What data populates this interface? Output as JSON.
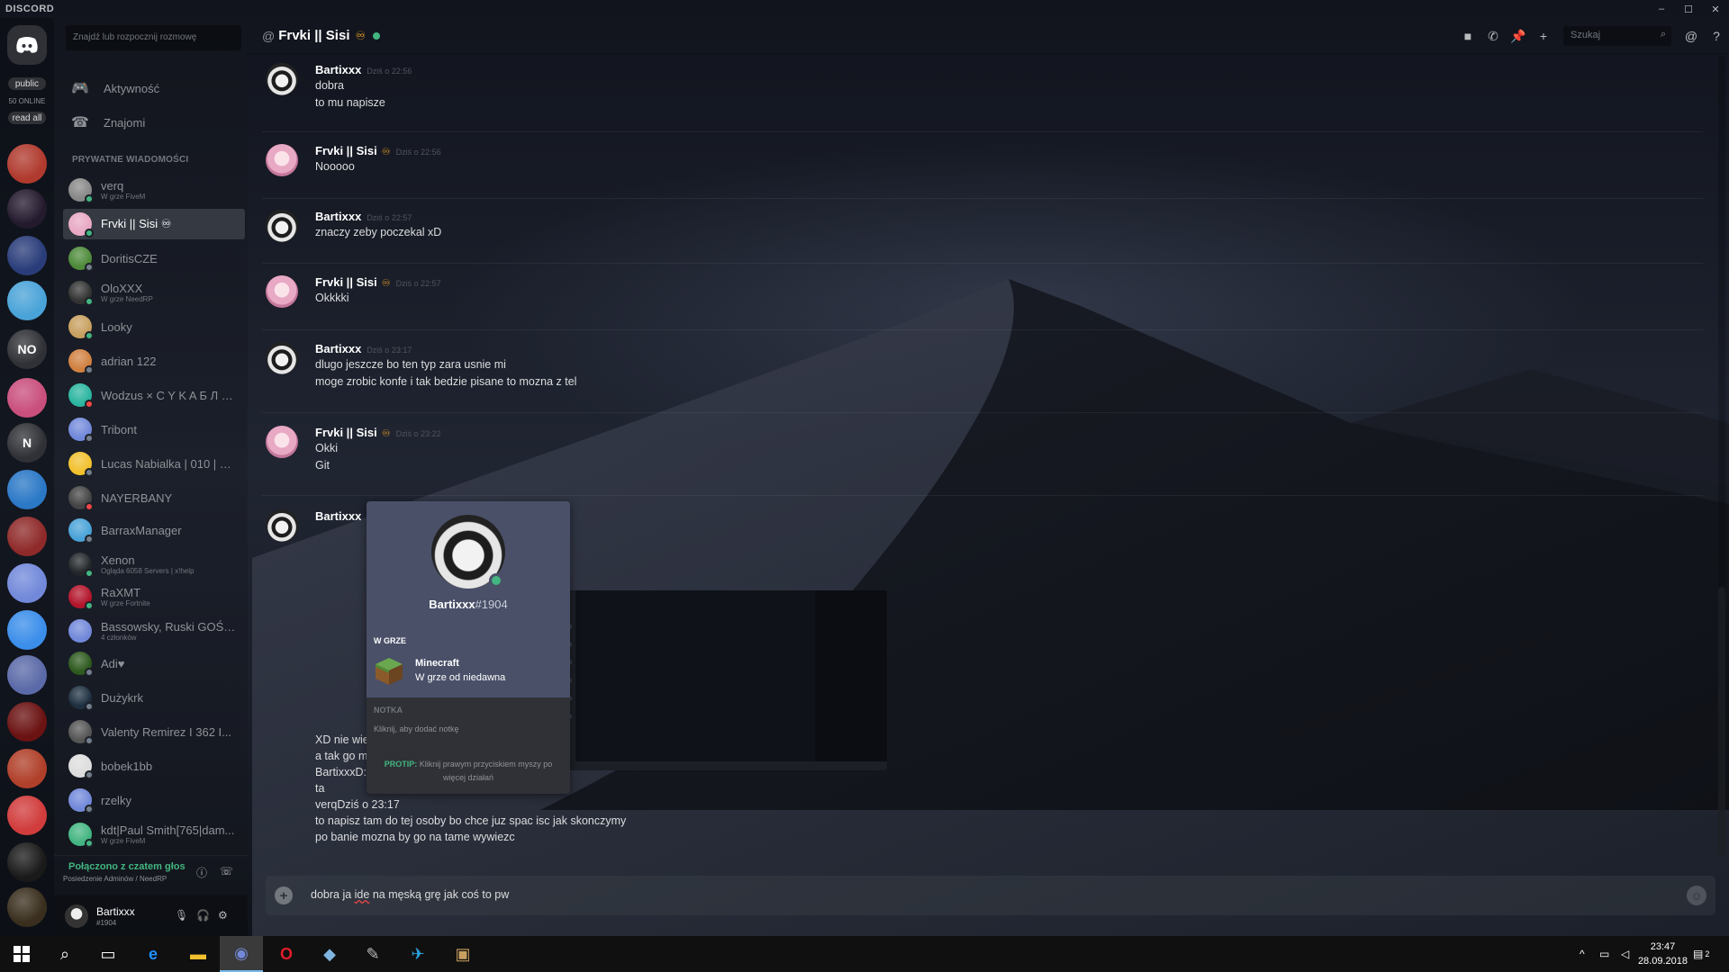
{
  "window": {
    "logo": "DISCORD",
    "controls": [
      "–",
      "☐",
      "✕"
    ]
  },
  "guilds": {
    "pill_public": "public",
    "online": "50 ONLINE",
    "pill_read": "read all",
    "items": [
      {
        "label": "",
        "color": "#b03a2e"
      },
      {
        "label": "",
        "color": "#241a2e"
      },
      {
        "label": "",
        "color": "#2a3d7a"
      },
      {
        "label": "",
        "color": "#4aa3d8"
      },
      {
        "label": "NO",
        "color": "#2f3136"
      },
      {
        "label": "",
        "color": "#c94f7c"
      },
      {
        "label": "N",
        "color": "#2f3136"
      },
      {
        "label": "",
        "color": "#2b78c6"
      },
      {
        "label": "",
        "color": "#8f2a2a"
      },
      {
        "label": "",
        "color": "#7289da"
      },
      {
        "label": "",
        "color": "#3b8eea"
      },
      {
        "label": "",
        "color": "#5b6aa8"
      },
      {
        "label": "",
        "color": "#6b1212"
      },
      {
        "label": "",
        "color": "#b0402a"
      },
      {
        "label": "",
        "color": "#d13c3c"
      },
      {
        "label": "",
        "color": "#1a1a1a"
      },
      {
        "label": "",
        "color": "#3a2f1e"
      }
    ]
  },
  "sidebar": {
    "search_placeholder": "Znajdź lub rozpocznij rozmowę",
    "nav": [
      {
        "label": "Aktywność",
        "icon": "gamepad-icon"
      },
      {
        "label": "Znajomi",
        "icon": "friends-icon"
      }
    ],
    "section": "PRYWATNE WIADOMOŚCI",
    "dms": [
      {
        "name": "verq",
        "sub": "W grze FiveM",
        "color": "#888",
        "status": "#43b581"
      },
      {
        "name": "Frvki || Sisi ♾",
        "sub": "",
        "color": "#e8a9c4",
        "status": "#43b581",
        "active": true
      },
      {
        "name": "DoritisCZE",
        "sub": "",
        "color": "#4d8a3a",
        "status": "#747f8d"
      },
      {
        "name": "OloXXX",
        "sub": "W grze NeedRP",
        "color": "#333",
        "status": "#43b581"
      },
      {
        "name": "Looky",
        "sub": "",
        "color": "#c8a060",
        "status": "#43b581"
      },
      {
        "name": "adrian 122",
        "sub": "",
        "color": "#d08040",
        "status": "#747f8d"
      },
      {
        "name": "Wodzus × C Y K A Б Л Я...",
        "sub": "",
        "color": "#2bb5a0",
        "status": "#f04747"
      },
      {
        "name": "Tribont",
        "sub": "",
        "color": "#7289da",
        "status": "#747f8d"
      },
      {
        "name": "Lucas Nabialka | 010 | m...",
        "sub": "",
        "color": "#f2c12e",
        "status": "#747f8d"
      },
      {
        "name": "NAYERBANY",
        "sub": "",
        "color": "#444",
        "status": "#f04747"
      },
      {
        "name": "BarraxManager",
        "sub": "",
        "color": "#4aa3d8",
        "status": "#747f8d"
      },
      {
        "name": "Xenon",
        "sub": "Ogląda 6058 Servers | x!help",
        "color": "#23272a",
        "status": "#43b581"
      },
      {
        "name": "RaXMT",
        "sub": "W grze Fortnite",
        "color": "#b3152b",
        "status": "#43b581"
      },
      {
        "name": "Bassowsky, Ruski GOŚĆ...",
        "sub": "4 członków",
        "color": "#7289da",
        "status": ""
      },
      {
        "name": "Adi♥",
        "sub": "",
        "color": "#2d5a1e",
        "status": "#747f8d"
      },
      {
        "name": "Dużykrk",
        "sub": "",
        "color": "#1e3040",
        "status": "#747f8d"
      },
      {
        "name": "Valenty Remirez I 362 I...",
        "sub": "",
        "color": "#555",
        "status": "#747f8d"
      },
      {
        "name": "bobek1bb",
        "sub": "",
        "color": "#ddd",
        "status": "#747f8d"
      },
      {
        "name": "rzelky",
        "sub": "",
        "color": "#7289da",
        "status": "#747f8d"
      },
      {
        "name": "kdt|Paul Smith[765|dam...",
        "sub": "W grze FiveM",
        "color": "#43b581",
        "status": "#43b581"
      }
    ],
    "voice": {
      "status": "Połączono z czatem głos",
      "channel": "Posiedzenie Adminów / NeedRP"
    },
    "user": {
      "name": "Bartixxx",
      "tag": "#1904"
    }
  },
  "header": {
    "prefix": "@",
    "title": "Frvki || Sisi",
    "badge": "♾",
    "search_placeholder": "Szukaj"
  },
  "messages": [
    {
      "author": "Bartixxx",
      "time": "Dziś o 22:56",
      "lines": [
        "dobra",
        "to mu napisze"
      ]
    },
    {
      "author": "Frvki || Sisi",
      "badge": "♾",
      "time": "Dziś o 22:56",
      "lines": [
        "Nooooo"
      ]
    },
    {
      "author": "Bartixxx",
      "time": "Dziś o 22:57",
      "lines": [
        "znaczy zeby poczekal xD"
      ]
    },
    {
      "author": "Frvki || Sisi",
      "badge": "♾",
      "time": "Dziś o 22:57",
      "lines": [
        "Okkkki"
      ]
    },
    {
      "author": "Bartixxx",
      "time": "Dziś o 23:17",
      "lines": [
        "dlugo jeszcze bo ten typ zara usnie mi",
        "moge zrobic konfe i tak bedzie pisane to mozna z tel"
      ]
    },
    {
      "author": "Frvki || Sisi",
      "badge": "♾",
      "time": "Dziś o 23:22",
      "lines": [
        "Okki",
        "Git"
      ]
    },
    {
      "author": "Bartixxx",
      "time": "",
      "lines": [
        "XD nie wie",
        "a tak go m",
        "BartixxxD:",
        "ta",
        "verqDziś o 23:17",
        "to napisz tam do tej osoby bo chce juz spac isc jak skonczymy",
        "po banie mozna by go na tame wywiezc"
      ]
    }
  ],
  "popout": {
    "name": "Bartixxx",
    "discrim": "#1904",
    "in_game_label": "W GRZE",
    "game": "Minecraft",
    "game_time": "W grze od niedawna",
    "note_label": "NOTKA",
    "note_placeholder": "Kliknij, aby dodać notkę",
    "protip_label": "PROTIP:",
    "protip_text": "Kliknij prawym przyciskiem myszy po więcej działań"
  },
  "composer": {
    "pre": "dobra ja ",
    "typo": "ide",
    "post": " na męską grę jak coś to pw"
  },
  "taskbar": {
    "time": "23:47",
    "date": "28.09.2018",
    "notif_count": "2"
  }
}
